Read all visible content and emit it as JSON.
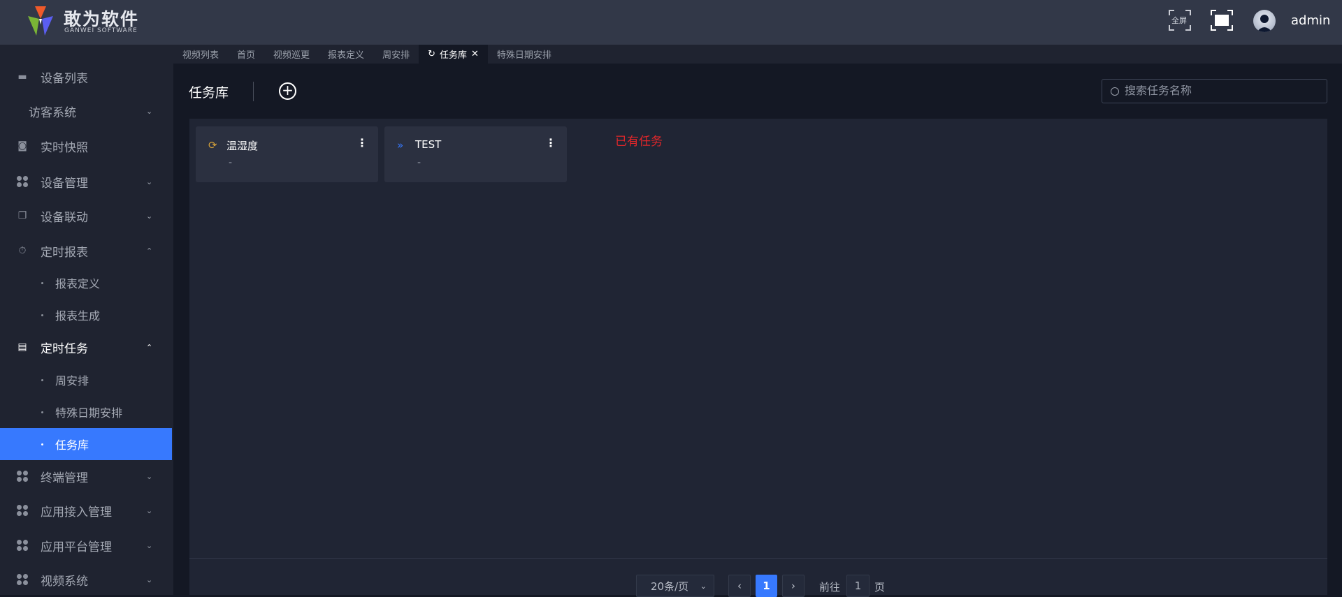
{
  "header": {
    "brand": "敢为软件",
    "brand_sub": "GANWEI SOFTWARE",
    "fullscreen_label": "全屏",
    "username": "admin"
  },
  "sidebar": {
    "items": [
      {
        "label": "设备列表",
        "icon": "monitor-icon"
      },
      {
        "label": "访客系统",
        "chevron": "⌄"
      },
      {
        "label": "实时快照",
        "icon": "camera-icon"
      },
      {
        "label": "设备管理",
        "icon": "clover-icon",
        "chevron": "⌄"
      },
      {
        "label": "设备联动",
        "icon": "link-icon",
        "chevron": "⌄"
      },
      {
        "label": "定时报表",
        "icon": "clock-icon",
        "chevron": "⌃"
      },
      {
        "label": "报表定义"
      },
      {
        "label": "报表生成"
      },
      {
        "label": "定时任务",
        "icon": "task-icon",
        "chevron": "⌃"
      },
      {
        "label": "周安排"
      },
      {
        "label": "特殊日期安排"
      },
      {
        "label": "任务库"
      },
      {
        "label": "终端管理",
        "chevron": "⌄"
      },
      {
        "label": "应用接入管理",
        "chevron": "⌄"
      },
      {
        "label": "应用平台管理",
        "chevron": "⌄"
      },
      {
        "label": "视频系统",
        "chevron": "⌄"
      }
    ]
  },
  "tabs": [
    {
      "label": "视频列表"
    },
    {
      "label": "首页"
    },
    {
      "label": "视频巡更"
    },
    {
      "label": "报表定义"
    },
    {
      "label": "周安排"
    },
    {
      "label": "任务库",
      "active": true
    },
    {
      "label": "特殊日期安排"
    }
  ],
  "toolbar": {
    "title": "任务库",
    "search_placeholder": "搜索任务名称"
  },
  "cards": [
    {
      "name": "温湿度",
      "desc": "-",
      "icon": "loop-icon",
      "color": "#d6a23a"
    },
    {
      "name": "TEST",
      "desc": "-",
      "icon": "chevrons-right-icon",
      "color": "#3779fe"
    }
  ],
  "notice": "已有任务",
  "pagination": {
    "page_size": "20条/页",
    "current": "1",
    "goto_label": "前往",
    "goto_value": "1",
    "page_suffix": "页"
  },
  "colors": {
    "accent": "#3779fe",
    "notice": "#e0262a"
  }
}
